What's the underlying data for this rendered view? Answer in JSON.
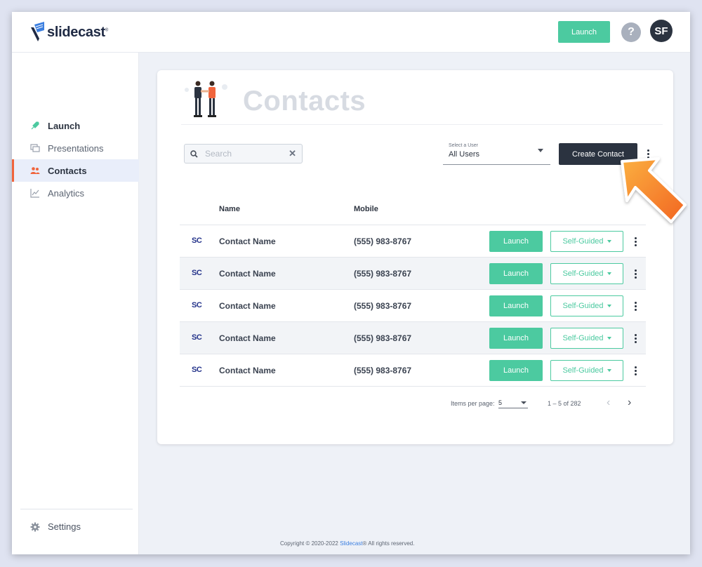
{
  "header": {
    "logo_text": "slidecast",
    "launch_label": "Launch",
    "help_label": "?",
    "avatar_initials": "SF"
  },
  "sidebar": {
    "items": [
      {
        "label": "Launch",
        "icon": "rocket-icon"
      },
      {
        "label": "Presentations",
        "icon": "presentations-icon"
      },
      {
        "label": "Contacts",
        "icon": "contacts-icon",
        "active": true
      },
      {
        "label": "Analytics",
        "icon": "analytics-icon"
      }
    ],
    "settings_label": "Settings"
  },
  "page": {
    "title": "Contacts",
    "search_placeholder": "Search",
    "user_select": {
      "label": "Select a User",
      "value": "All Users"
    },
    "create_label": "Create Contact"
  },
  "table": {
    "columns": {
      "name": "Name",
      "mobile": "Mobile"
    },
    "rows": [
      {
        "logo": "SC",
        "name": "Contact Name",
        "mobile": "(555) 983-8767",
        "launch": "Launch",
        "mode": "Self-Guided"
      },
      {
        "logo": "SC",
        "name": "Contact Name",
        "mobile": "(555) 983-8767",
        "launch": "Launch",
        "mode": "Self-Guided"
      },
      {
        "logo": "SC",
        "name": "Contact Name",
        "mobile": "(555) 983-8767",
        "launch": "Launch",
        "mode": "Self-Guided"
      },
      {
        "logo": "SC",
        "name": "Contact Name",
        "mobile": "(555) 983-8767",
        "launch": "Launch",
        "mode": "Self-Guided"
      },
      {
        "logo": "SC",
        "name": "Contact Name",
        "mobile": "(555) 983-8767",
        "launch": "Launch",
        "mode": "Self-Guided"
      }
    ]
  },
  "pagination": {
    "items_per_page_label": "Items per page:",
    "items_per_page": "5",
    "range": "1 – 5 of 282"
  },
  "footer": {
    "prefix": "Copyright © 2020-2022 ",
    "brand": "Slidecast",
    "suffix": "® All rights reserved."
  },
  "colors": {
    "accent_green": "#4ccaa0",
    "dark": "#2b3340",
    "active_marker": "#f0643c",
    "arrow_orange": "#f7941d"
  }
}
